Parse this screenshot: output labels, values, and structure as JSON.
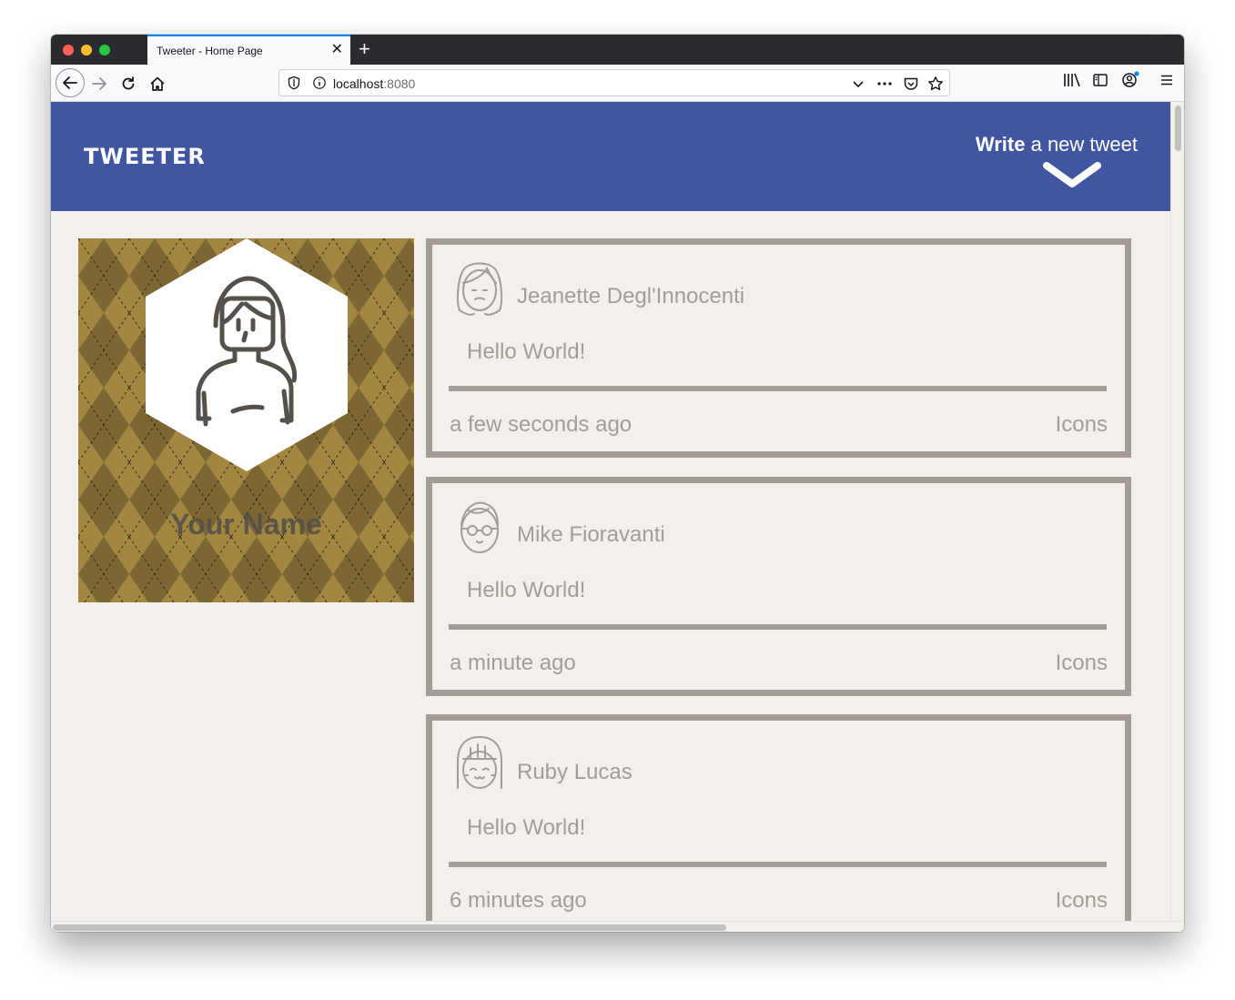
{
  "browser": {
    "tab_title": "Tweeter - Home Page",
    "url_host": "localhost",
    "url_port": ":8080"
  },
  "header": {
    "logo": "TWEETER",
    "compose_bold": "Write",
    "compose_rest": " a new tweet"
  },
  "profile": {
    "name": "Your Name",
    "background_color": "#a38640"
  },
  "tweets": [
    {
      "author": "Jeanette Degl'Innocenti",
      "text": "Hello World!",
      "time": "a few seconds ago",
      "icons_label": "Icons"
    },
    {
      "author": "Mike Fioravanti",
      "text": "Hello World!",
      "time": "a minute ago",
      "icons_label": "Icons"
    },
    {
      "author": "Ruby Lucas",
      "text": "Hello World!",
      "time": "6 minutes ago",
      "icons_label": "Icons"
    }
  ],
  "colors": {
    "header": "#4056a1",
    "page_bg": "#f3f0ec",
    "tweet_border": "#a49d97"
  }
}
